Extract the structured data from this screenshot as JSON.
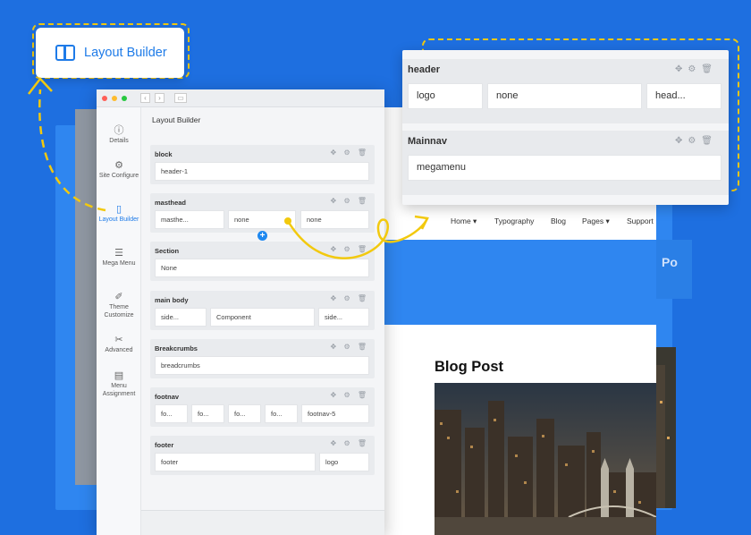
{
  "badge": {
    "label": "Layout Builder",
    "icon": "layout-panel-icon"
  },
  "window": {
    "title_dots": [
      "#ff5f57",
      "#febc2e",
      "#28c840"
    ],
    "panel_title": "Layout Builder",
    "sidebar": [
      {
        "label": "Details",
        "icon": "info-icon",
        "glyph": "ⓘ"
      },
      {
        "label": "Site Configure",
        "icon": "gears-icon",
        "glyph": "⚙"
      },
      {
        "label": "Layout Builder",
        "icon": "layout-panel-icon",
        "glyph": "▯",
        "active": true
      },
      {
        "label": "Mega Menu",
        "icon": "menu-icon",
        "glyph": "☰"
      },
      {
        "label": "Theme Customize",
        "icon": "magic-wand-icon",
        "glyph": "✐"
      },
      {
        "label": "Advanced",
        "icon": "tools-icon",
        "glyph": "✂"
      },
      {
        "label": "Menu Assignment",
        "icon": "assignment-icon",
        "glyph": "▤"
      }
    ],
    "rows": [
      {
        "title": "block",
        "cells": [
          "header-1"
        ]
      },
      {
        "title": "masthead",
        "cells": [
          "masthe...",
          "none",
          "none"
        ]
      },
      {
        "title": "Section",
        "cells": [
          "None"
        ]
      },
      {
        "title": "main body",
        "cells": [
          "side...",
          "Component",
          "side..."
        ]
      },
      {
        "title": "Breakcrumbs",
        "cells": [
          "breadcrumbs"
        ]
      },
      {
        "title": "footnav",
        "cells": [
          "fo...",
          "fo...",
          "fo...",
          "fo...",
          "footnav-5"
        ]
      },
      {
        "title": "footer",
        "cells": [
          "footer",
          "logo"
        ]
      }
    ],
    "row_controls": [
      "move-icon",
      "settings-icon",
      "trash-icon"
    ]
  },
  "header_panel": {
    "rows": [
      {
        "title": "header",
        "cells": [
          "logo",
          "none",
          "head..."
        ]
      },
      {
        "title": "Mainnav",
        "cells": [
          "megamenu"
        ]
      }
    ]
  },
  "site": {
    "nav": [
      "Home ▾",
      "Typography",
      "Blog",
      "Pages ▾",
      "Support"
    ],
    "hero_right_text": "Po",
    "blog_title": "Blog Post"
  },
  "colors": {
    "accent": "#1e7be8",
    "highlight": "#f2c90e",
    "background": "#1e6fe0"
  }
}
